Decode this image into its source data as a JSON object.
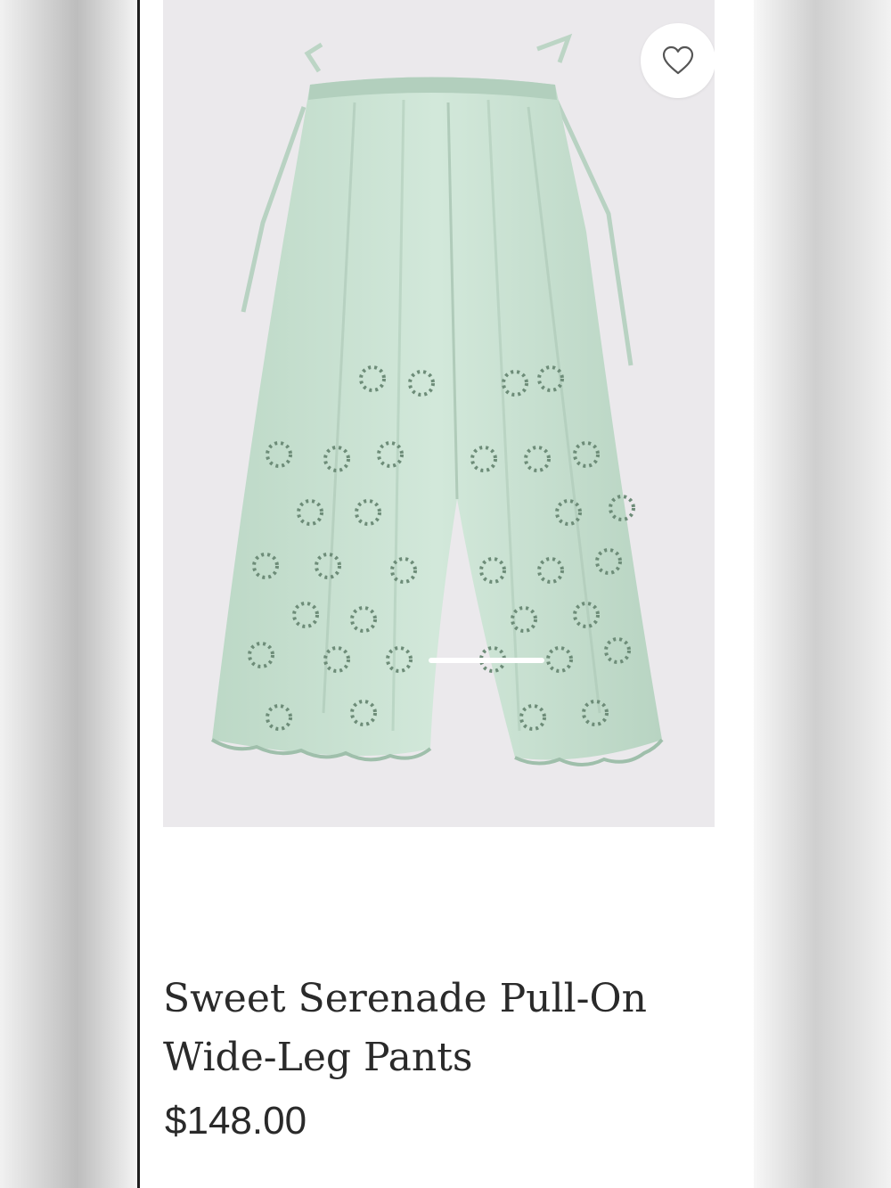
{
  "product": {
    "title": "Sweet Serenade Pull-On Wide-Leg Pants",
    "price": "$148.00",
    "image_icon": "product-photo-mint-eyelet-pants",
    "favorite_icon": "heart-icon"
  },
  "colors": {
    "garment": "#c9e2d2",
    "image_background": "#ebe9ec",
    "text": "#2a2a2a"
  }
}
